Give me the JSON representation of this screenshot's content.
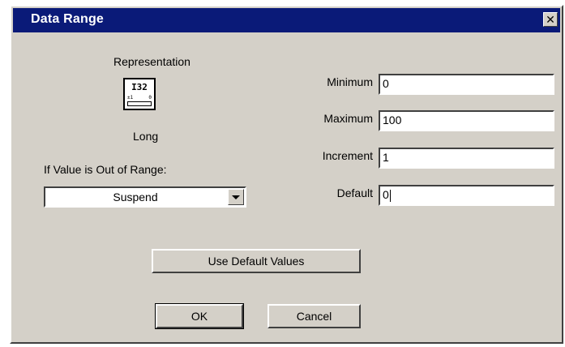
{
  "dialog": {
    "title": "Data Range",
    "close_icon": "close-icon"
  },
  "representation": {
    "label": "Representation",
    "icon_text": "I32",
    "icon_left_mark": "±1",
    "icon_right_mark": "0",
    "type_label": "Long"
  },
  "out_of_range": {
    "label": "If Value is Out of Range:",
    "selected": "Suspend"
  },
  "fields": {
    "minimum": {
      "label": "Minimum",
      "value": "0"
    },
    "maximum": {
      "label": "Maximum",
      "value": "100"
    },
    "increment": {
      "label": "Increment",
      "value": "1"
    },
    "default": {
      "label": "Default",
      "value": "0"
    }
  },
  "buttons": {
    "use_default": "Use Default Values",
    "ok": "OK",
    "cancel": "Cancel"
  }
}
